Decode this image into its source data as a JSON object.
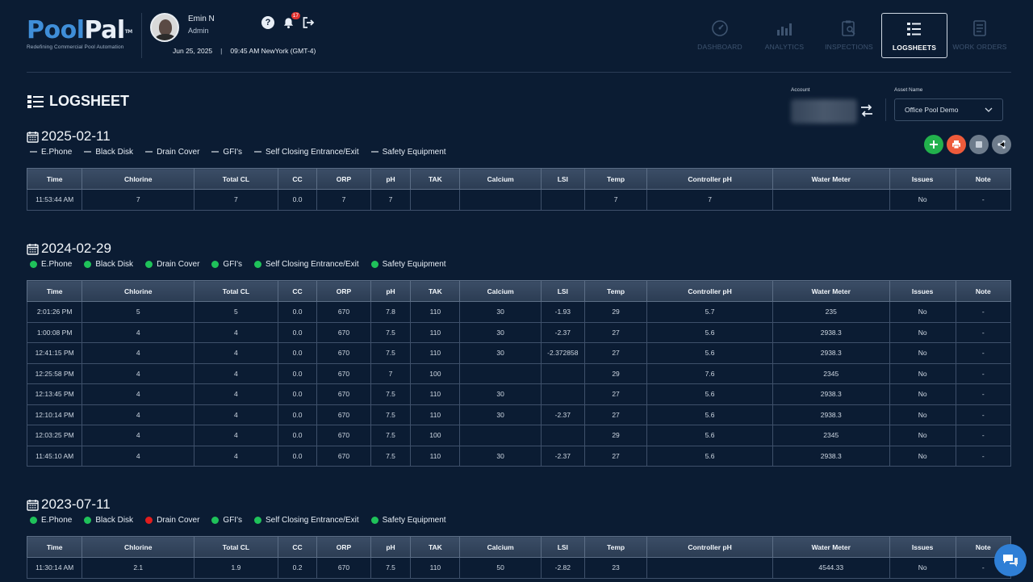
{
  "header": {
    "logo_pool": "Pool",
    "logo_pal": "Pal",
    "logo_tm": "TM",
    "tagline": "Redefining Commercial Pool Automation",
    "user_name": "Emin N",
    "user_role": "Admin",
    "date": "Jun 25, 2025",
    "separator": "|",
    "time": "09:45 AM NewYork (GMT-4)",
    "notification_count": "17",
    "help_label": "?"
  },
  "nav": [
    {
      "label": "DASHBOARD",
      "icon": "gauge-icon",
      "active": false
    },
    {
      "label": "ANALYTICS",
      "icon": "bar-chart-icon",
      "active": false
    },
    {
      "label": "INSPECTIONS",
      "icon": "clipboard-search-icon",
      "active": false
    },
    {
      "label": "LOGSHEETS",
      "icon": "list-icon",
      "active": true
    },
    {
      "label": "WORK ORDERS",
      "icon": "document-icon",
      "active": false
    }
  ],
  "page": {
    "title": "LOGSHEET",
    "account_label": "Account",
    "asset_label": "Asset Name",
    "asset_value": "Office Pool Demo"
  },
  "columns": [
    "Time",
    "Chlorine",
    "Total CL",
    "CC",
    "ORP",
    "pH",
    "TAK",
    "Calcium",
    "LSI",
    "Temp",
    "Controller pH",
    "Water Meter",
    "Issues",
    "Note"
  ],
  "sections": [
    {
      "date": "2025-02-11",
      "statuses": [
        {
          "label": "E.Phone",
          "state": "none"
        },
        {
          "label": "Black Disk",
          "state": "none"
        },
        {
          "label": "Drain Cover",
          "state": "none"
        },
        {
          "label": "GFI's",
          "state": "none"
        },
        {
          "label": "Self Closing Entrance/Exit",
          "state": "none"
        },
        {
          "label": "Safety Equipment",
          "state": "none"
        }
      ],
      "rows": [
        [
          "11:53:44 AM",
          "7",
          "7",
          "0.0",
          "7",
          "7",
          "",
          "",
          "",
          "7",
          "7",
          "",
          "No",
          "-"
        ]
      ]
    },
    {
      "date": "2024-02-29",
      "statuses": [
        {
          "label": "E.Phone",
          "state": "ok"
        },
        {
          "label": "Black Disk",
          "state": "ok"
        },
        {
          "label": "Drain Cover",
          "state": "ok"
        },
        {
          "label": "GFI's",
          "state": "ok"
        },
        {
          "label": "Self Closing Entrance/Exit",
          "state": "ok"
        },
        {
          "label": "Safety Equipment",
          "state": "ok"
        }
      ],
      "rows": [
        [
          "2:01:26 PM",
          "5",
          "5",
          "0.0",
          "670",
          "7.8",
          "110",
          "30",
          "-1.93",
          "29",
          "5.7",
          "235",
          "No",
          "-"
        ],
        [
          "1:00:08 PM",
          "4",
          "4",
          "0.0",
          "670",
          "7.5",
          "110",
          "30",
          "-2.37",
          "27",
          "5.6",
          "2938.3",
          "No",
          "-"
        ],
        [
          "12:41:15 PM",
          "4",
          "4",
          "0.0",
          "670",
          "7.5",
          "110",
          "30",
          "-2.372858",
          "27",
          "5.6",
          "2938.3",
          "No",
          "-"
        ],
        [
          "12:25:58 PM",
          "4",
          "4",
          "0.0",
          "670",
          "7",
          "100",
          "",
          "",
          "29",
          "7.6",
          "2345",
          "No",
          "-"
        ],
        [
          "12:13:45 PM",
          "4",
          "4",
          "0.0",
          "670",
          "7.5",
          "110",
          "30",
          "",
          "27",
          "5.6",
          "2938.3",
          "No",
          "-"
        ],
        [
          "12:10:14 PM",
          "4",
          "4",
          "0.0",
          "670",
          "7.5",
          "110",
          "30",
          "-2.37",
          "27",
          "5.6",
          "2938.3",
          "No",
          "-"
        ],
        [
          "12:03:25 PM",
          "4",
          "4",
          "0.0",
          "670",
          "7.5",
          "100",
          "",
          "",
          "29",
          "5.6",
          "2345",
          "No",
          "-"
        ],
        [
          "11:45:10 AM",
          "4",
          "4",
          "0.0",
          "670",
          "7.5",
          "110",
          "30",
          "-2.37",
          "27",
          "5.6",
          "2938.3",
          "No",
          "-"
        ]
      ]
    },
    {
      "date": "2023-07-11",
      "statuses": [
        {
          "label": "E.Phone",
          "state": "ok"
        },
        {
          "label": "Black Disk",
          "state": "ok"
        },
        {
          "label": "Drain Cover",
          "state": "fail"
        },
        {
          "label": "GFI's",
          "state": "ok"
        },
        {
          "label": "Self Closing Entrance/Exit",
          "state": "ok"
        },
        {
          "label": "Safety Equipment",
          "state": "ok"
        }
      ],
      "rows": [
        [
          "11:30:14 AM",
          "2.1",
          "1.9",
          "0.2",
          "670",
          "7.5",
          "110",
          "50",
          "-2.82",
          "23",
          "",
          "4544.33",
          "No",
          "-"
        ]
      ]
    }
  ],
  "colors": {
    "ok": "#1fc25a",
    "fail": "#e11d1d",
    "none": "#8893a0",
    "accent": "#3f8ed8"
  }
}
